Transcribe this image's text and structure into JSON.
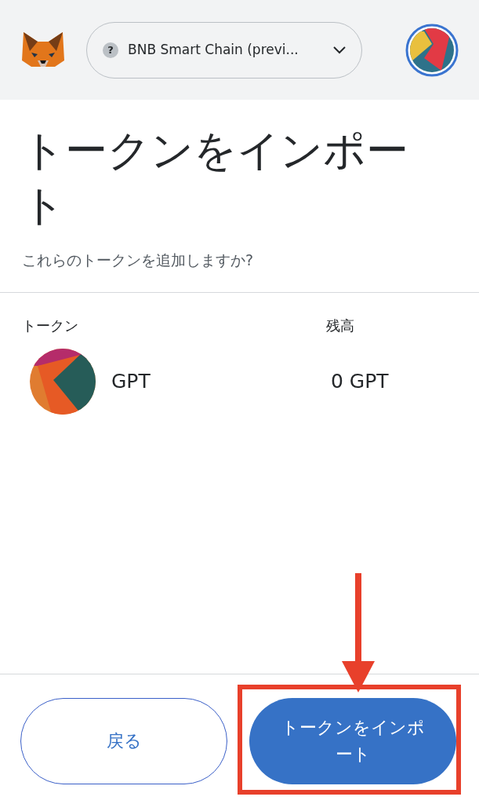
{
  "header": {
    "network": {
      "icon_glyph": "?",
      "label": "BNB Smart Chain (previ..."
    }
  },
  "title": "トークンをインポート",
  "subtitle": "これらのトークンを追加しますか?",
  "table": {
    "columns": [
      "トークン",
      "残高"
    ],
    "rows": [
      {
        "symbol": "GPT",
        "balance": "0 GPT"
      }
    ]
  },
  "buttons": [
    {
      "kind": "secondary",
      "label": "戻る"
    },
    {
      "kind": "primary",
      "label": "トークンをインポート"
    }
  ]
}
